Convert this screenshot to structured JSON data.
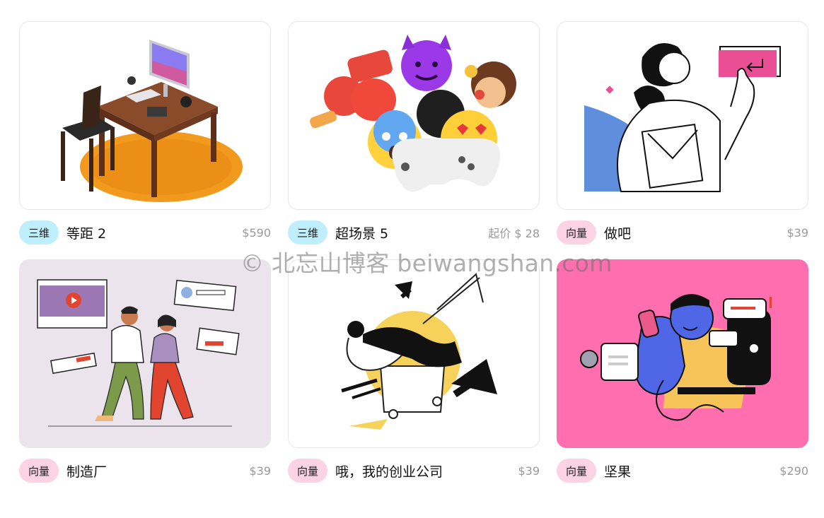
{
  "products": [
    {
      "badge": "三维",
      "badge_type": "3d",
      "title": "等距 2",
      "price": "$590",
      "bg": "#ffffff"
    },
    {
      "badge": "三维",
      "badge_type": "3d",
      "title": "超场景 5",
      "price": "起价 $ 28",
      "bg": "#ffffff"
    },
    {
      "badge": "向量",
      "badge_type": "vector",
      "title": "做吧",
      "price": "$39",
      "bg": "#ffffff"
    },
    {
      "badge": "向量",
      "badge_type": "vector",
      "title": "制造厂",
      "price": "$39",
      "bg": "#ece4ec"
    },
    {
      "badge": "向量",
      "badge_type": "vector",
      "title": "哦，我的创业公司",
      "price": "$39",
      "bg": "#ffffff"
    },
    {
      "badge": "向量",
      "badge_type": "vector",
      "title": "坚果",
      "price": "$290",
      "bg": "#ff6fb0"
    }
  ],
  "watermark": "© 北忘山博客 beiwangshan.com",
  "colors": {
    "badge_3d": "#bfeefc",
    "badge_vector": "#fbd3e3",
    "price": "#9a9a9a"
  }
}
